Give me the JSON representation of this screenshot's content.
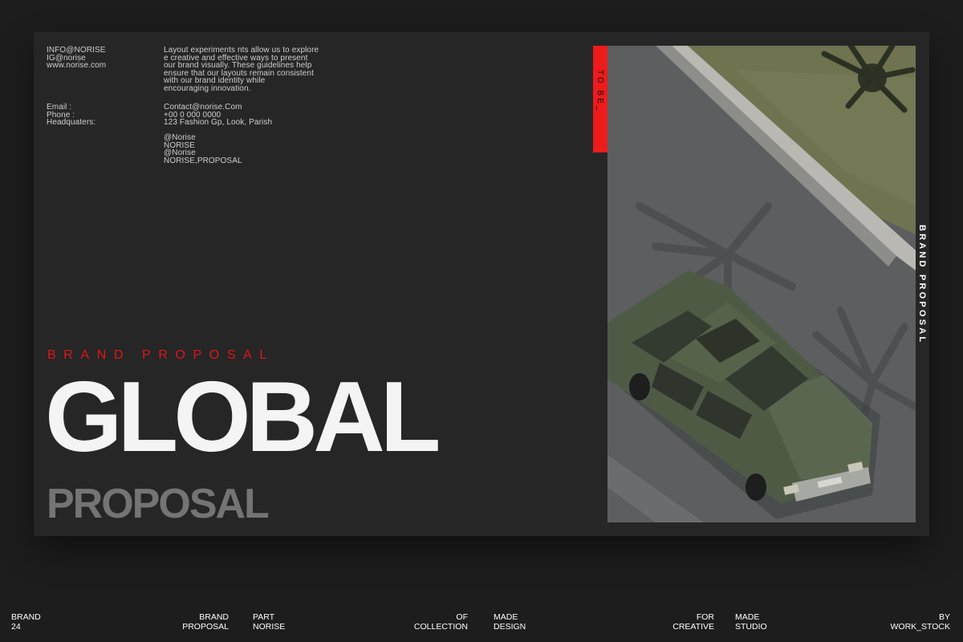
{
  "contact_top": {
    "lines": [
      "INFO@NORISE",
      "IG@norise",
      "www.norise.com"
    ]
  },
  "intro": {
    "lines": [
      "Layout experiments nts allow us to explore",
      "e creative and effective ways to present",
      "our brand visually. These guidelines help",
      "ensure that our layouts remain consistent",
      "with our brand identity while",
      "encouraging innovation."
    ]
  },
  "contact_labels": [
    "Email :",
    "Phone :",
    "Headquaters:"
  ],
  "contact_values": [
    "Contact@norise.Com",
    "+00 0 000 0000",
    "123 Fashion Gp, Look, Parish"
  ],
  "social": [
    "@Norise",
    "NORISE",
    "@Norise",
    "NORISE,PROPOSAL"
  ],
  "kicker": "BRAND PROPOSAL",
  "headline": "GLOBAL",
  "subhead": "PROPOSAL",
  "red_tab": "TO BE_",
  "vertical_label": "BRAND PROPOSAL",
  "colors": {
    "accent": "#ed1b1b",
    "background": "#1d1d1e",
    "slide": "#262627",
    "subhead": "#747474"
  },
  "footer": [
    {
      "id": "brand",
      "lines": [
        "BRAND",
        "24"
      ]
    },
    {
      "id": "brand-proposal",
      "lines": [
        "BRAND",
        "PROPOSAL"
      ]
    },
    {
      "id": "part",
      "lines": [
        "PART",
        "NORISE"
      ]
    },
    {
      "id": "collection",
      "lines": [
        "OF",
        "COLLECTION"
      ]
    },
    {
      "id": "made-design",
      "lines": [
        "MADE",
        "DESIGN"
      ]
    },
    {
      "id": "creative",
      "lines": [
        "FOR",
        "CREATIVE"
      ]
    },
    {
      "id": "studio",
      "lines": [
        "MADE",
        "STUDIO"
      ]
    },
    {
      "id": "work-stock",
      "lines": [
        "BY",
        "WORK_STOCK"
      ]
    }
  ]
}
